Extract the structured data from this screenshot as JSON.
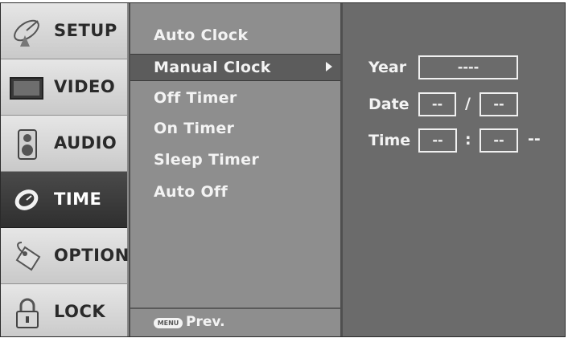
{
  "categories": [
    {
      "label": "SETUP",
      "icon": "satellite-dish-icon"
    },
    {
      "label": "VIDEO",
      "icon": "tv-screen-icon"
    },
    {
      "label": "AUDIO",
      "icon": "speaker-icon"
    },
    {
      "label": "TIME",
      "icon": "clock-icon",
      "selected": true
    },
    {
      "label": "OPTION",
      "icon": "tag-icon"
    },
    {
      "label": "LOCK",
      "icon": "padlock-icon"
    }
  ],
  "submenu": {
    "items": [
      {
        "label": "Auto Clock"
      },
      {
        "label": "Manual Clock",
        "selected": true
      },
      {
        "label": "Off Timer"
      },
      {
        "label": "On Timer"
      },
      {
        "label": "Sleep Timer"
      },
      {
        "label": "Auto Off"
      }
    ],
    "footer": {
      "button_label": "MENU",
      "text": "Prev."
    }
  },
  "settings": {
    "year": {
      "label": "Year",
      "value": "----"
    },
    "date": {
      "label": "Date",
      "month": "--",
      "separator": "/",
      "day": "--"
    },
    "time": {
      "label": "Time",
      "hour": "--",
      "separator": ":",
      "minute": "--",
      "ampm": "--"
    }
  },
  "colors": {
    "selected_category_bg": "#3a3a3a",
    "panel_bg": "#6b6b6b",
    "submenu_bg": "#8e8e8e"
  }
}
